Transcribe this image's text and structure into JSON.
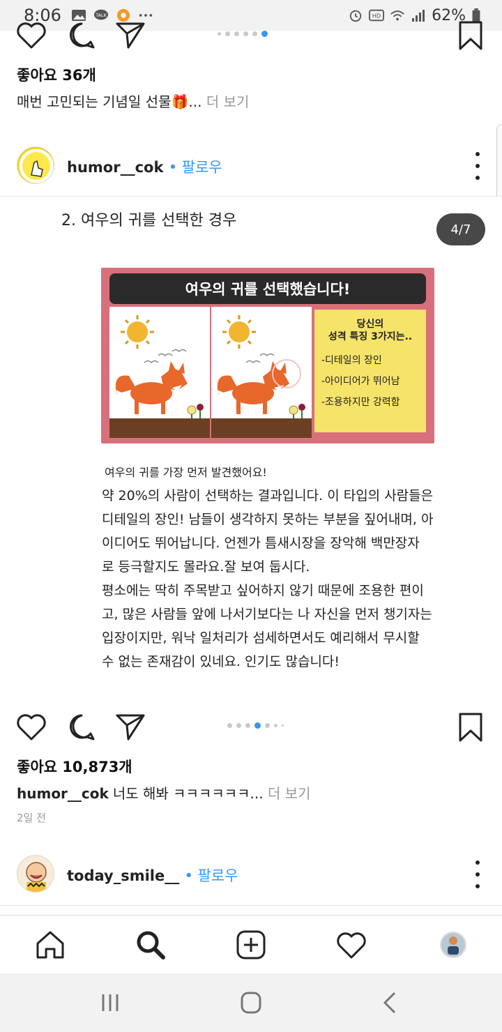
{
  "status_bar": {
    "time": "8:06",
    "battery": "62%",
    "left_icons": [
      "gallery-icon",
      "kakaotalk-icon",
      "orange-app-icon",
      "more-icon"
    ],
    "right_icons": [
      "alarm-icon",
      "hd-icon",
      "wifi-icon",
      "signal-icon",
      "battery-icon"
    ]
  },
  "post1": {
    "likes": "좋아요 36개",
    "caption": "매번 고민되는 기념일 선물🎁...",
    "more": "더 보기"
  },
  "post2": {
    "username": "humor__cok",
    "follow": "• 팔로우",
    "counter": "4/7",
    "image": {
      "heading": "2. 여우의 귀를 선택한 경우",
      "panel_title": "여우의 귀를 선택했습니다!",
      "info_title_1": "당신의",
      "info_title_2": "성격 특징 3가지는..",
      "traits": [
        "-디테일의 장인",
        "-아이디어가 뛰어남",
        "-조용하지만 강력함"
      ],
      "lines": [
        "여우의 귀를 가장 먼저 발견했어요!",
        "약 20%의 사람이 선택하는 결과입니다. 이 타입의 사람들은",
        "디테일의 장인! 남들이 생각하지 못하는 부분을 짚어내며, 아",
        "이디어도 뛰어납니다. 언젠가 틈새시장을 장악해 백만장자",
        "로 등극할지도 몰라요.잘 보여 둡시다.",
        "평소에는 딱히 주목받고 싶어하지 않기 때문에 조용한 편이",
        "고, 많은 사람들 앞에 나서기보다는 나 자신을 먼저 챙기자는",
        "입장이지만, 워낙 일처리가 섬세하면서도 예리해서 무시할",
        "수 없는 존재감이 있네요. 인기도 많습니다!"
      ]
    },
    "likes": "좋아요 10,873개",
    "caption_user": "humor__cok",
    "caption": "너도 해봐 ㅋㅋㅋㅋㅋㅋ...",
    "more": "더 보기",
    "time_ago": "2일 전"
  },
  "post3": {
    "username": "today_smile__",
    "follow": "• 팔로우"
  },
  "colors": {
    "accent": "#3897f0",
    "panel": "#d8707c",
    "info_box": "#f6e36a"
  }
}
